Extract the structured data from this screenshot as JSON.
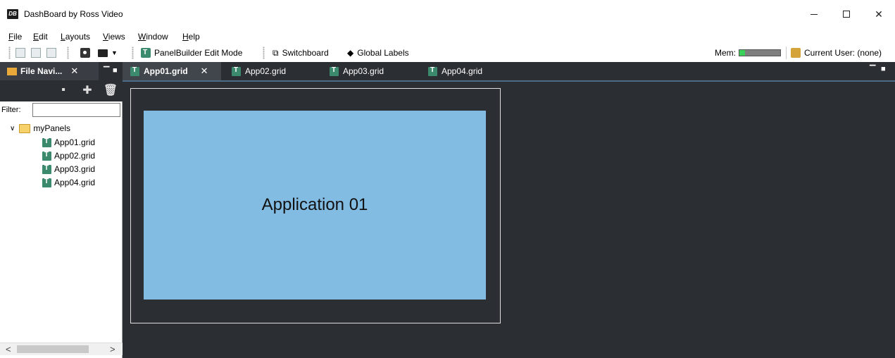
{
  "window": {
    "app_icon": "DB",
    "title": "DashBoard by Ross Video",
    "minimize": "–",
    "close": "✕"
  },
  "menu": [
    {
      "label": "File",
      "u": "F",
      "rest": "ile"
    },
    {
      "label": "Edit",
      "u": "E",
      "rest": "dit"
    },
    {
      "label": "Layouts",
      "u": "L",
      "rest": "ayouts"
    },
    {
      "label": "Views",
      "u": "V",
      "rest": "iews"
    },
    {
      "label": "Window",
      "u": "W",
      "rest": "indow"
    },
    {
      "label": "Help",
      "u": "H",
      "rest": "elp"
    }
  ],
  "toolbar": {
    "panelbuilder": "PanelBuilder Edit Mode",
    "switchboard": "Switchboard",
    "global_labels": "Global Labels",
    "mem_label": "Mem:",
    "current_user": "Current User: (none)"
  },
  "left_panel": {
    "tab_label": "File Navi...",
    "tab_close": "✕",
    "filter_label": "Filter:",
    "filter_value": "",
    "tree": {
      "folder": "myPanels",
      "files": [
        "App01.grid",
        "App02.grid",
        "App03.grid",
        "App04.grid"
      ]
    },
    "scroll_left": "<",
    "scroll_right": ">"
  },
  "tabs": [
    {
      "label": "App01.grid",
      "active": true
    },
    {
      "label": "App02.grid",
      "active": false
    },
    {
      "label": "App03.grid",
      "active": false
    },
    {
      "label": "App04.grid",
      "active": false
    }
  ],
  "active_tab_close": "✕",
  "canvas": {
    "app_label": "Application 01",
    "app_color": "#83bce3"
  },
  "colors": {
    "dark_bg": "#2b2e33",
    "active_tab": "#41464d",
    "grid_icon": "#3c8a6e"
  }
}
